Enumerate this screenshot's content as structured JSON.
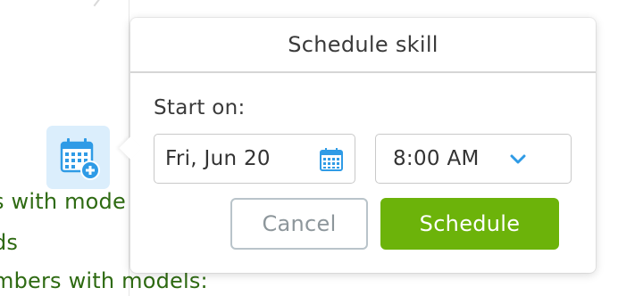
{
  "background": {
    "lines": [
      "s with mode",
      "ds",
      "mbers with models:"
    ]
  },
  "trigger": {
    "icon": "calendar-add-icon"
  },
  "popover": {
    "title": "Schedule skill",
    "start_label": "Start on:",
    "date": {
      "value": "Fri, Jun 20",
      "icon": "calendar-icon"
    },
    "time": {
      "value": "8:00 AM",
      "icon": "chevron-down-icon"
    },
    "buttons": {
      "cancel": "Cancel",
      "schedule": "Schedule"
    }
  },
  "colors": {
    "accent_blue": "#2f9be6",
    "schedule_green": "#6cb30a",
    "background_text_green": "#2e6a12",
    "trigger_bg": "#dbeefc"
  }
}
